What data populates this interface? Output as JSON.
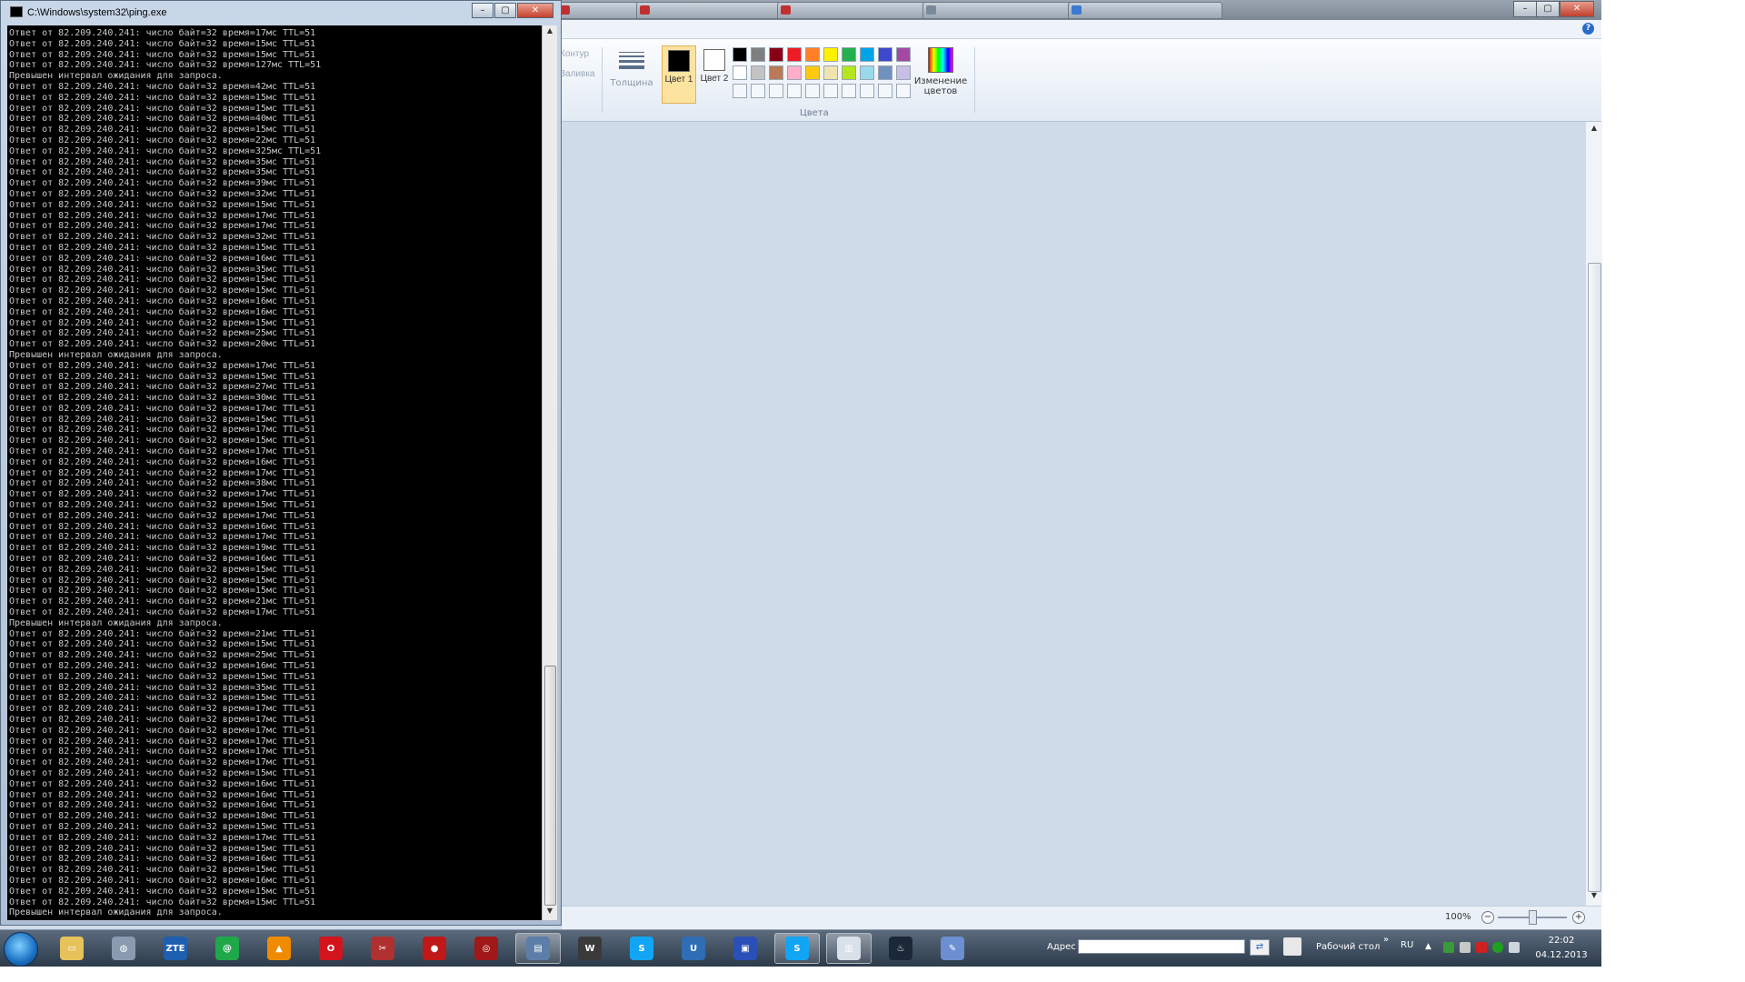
{
  "paint": {
    "tabs": [
      "",
      "",
      "",
      "",
      ""
    ],
    "window_buttons": {
      "minimize": "–",
      "maximize": "▢",
      "close": "✕"
    },
    "help": "?",
    "ribbon": {
      "outline_label": "Контур",
      "fill_label": "Заливка",
      "thickness_label": "Толщина",
      "color1_label": "Цвет 1",
      "color2_label": "Цвет 2",
      "colors_group_label": "Цвета",
      "edit_colors_label": "Изменение цветов",
      "color1_value": "#000000",
      "color2_value": "#ffffff",
      "palette": [
        "#000000",
        "#7f7f7f",
        "#880015",
        "#ed1c24",
        "#ff7f27",
        "#fff200",
        "#22b14c",
        "#00a2e8",
        "#3f48cc",
        "#a349a4",
        "#ffffff",
        "#c3c3c3",
        "#b97a57",
        "#ffaec9",
        "#ffc90e",
        "#efe4b0",
        "#b5e61d",
        "#99d9ea",
        "#7092be",
        "#c8bfe7",
        "#f4f7fb",
        "#f4f7fb",
        "#f4f7fb",
        "#f4f7fb",
        "#f4f7fb",
        "#f4f7fb",
        "#f4f7fb",
        "#f4f7fb",
        "#f4f7fb",
        "#f4f7fb"
      ]
    },
    "status": {
      "zoom": "100%",
      "zoom_out": "−",
      "zoom_in": "+",
      "zoom_fraction": 0.5
    }
  },
  "console": {
    "title": "C:\\Windows\\system32\\ping.exe",
    "buttons": {
      "minimize": "–",
      "maximize": "▢",
      "close": "✕"
    },
    "lines": [
      "Ответ от 82.209.240.241: число байт=32 время=17мс TTL=51",
      "Ответ от 82.209.240.241: число байт=32 время=15мс TTL=51",
      "Ответ от 82.209.240.241: число байт=32 время=15мс TTL=51",
      "Ответ от 82.209.240.241: число байт=32 время=127мс TTL=51",
      "Превышен интервал ожидания для запроса.",
      "Ответ от 82.209.240.241: число байт=32 время=42мс TTL=51",
      "Ответ от 82.209.240.241: число байт=32 время=15мс TTL=51",
      "Ответ от 82.209.240.241: число байт=32 время=15мс TTL=51",
      "Ответ от 82.209.240.241: число байт=32 время=40мс TTL=51",
      "Ответ от 82.209.240.241: число байт=32 время=15мс TTL=51",
      "Ответ от 82.209.240.241: число байт=32 время=22мс TTL=51",
      "Ответ от 82.209.240.241: число байт=32 время=325мс TTL=51",
      "Ответ от 82.209.240.241: число байт=32 время=35мс TTL=51",
      "Ответ от 82.209.240.241: число байт=32 время=35мс TTL=51",
      "Ответ от 82.209.240.241: число байт=32 время=39мс TTL=51",
      "Ответ от 82.209.240.241: число байт=32 время=32мс TTL=51",
      "Ответ от 82.209.240.241: число байт=32 время=15мс TTL=51",
      "Ответ от 82.209.240.241: число байт=32 время=17мс TTL=51",
      "Ответ от 82.209.240.241: число байт=32 время=17мс TTL=51",
      "Ответ от 82.209.240.241: число байт=32 время=32мс TTL=51",
      "Ответ от 82.209.240.241: число байт=32 время=15мс TTL=51",
      "Ответ от 82.209.240.241: число байт=32 время=16мс TTL=51",
      "Ответ от 82.209.240.241: число байт=32 время=35мс TTL=51",
      "Ответ от 82.209.240.241: число байт=32 время=15мс TTL=51",
      "Ответ от 82.209.240.241: число байт=32 время=15мс TTL=51",
      "Ответ от 82.209.240.241: число байт=32 время=16мс TTL=51",
      "Ответ от 82.209.240.241: число байт=32 время=16мс TTL=51",
      "Ответ от 82.209.240.241: число байт=32 время=15мс TTL=51",
      "Ответ от 82.209.240.241: число байт=32 время=25мс TTL=51",
      "Ответ от 82.209.240.241: число байт=32 время=20мс TTL=51",
      "Превышен интервал ожидания для запроса.",
      "Ответ от 82.209.240.241: число байт=32 время=17мс TTL=51",
      "Ответ от 82.209.240.241: число байт=32 время=15мс TTL=51",
      "Ответ от 82.209.240.241: число байт=32 время=27мс TTL=51",
      "Ответ от 82.209.240.241: число байт=32 время=30мс TTL=51",
      "Ответ от 82.209.240.241: число байт=32 время=17мс TTL=51",
      "Ответ от 82.209.240.241: число байт=32 время=15мс TTL=51",
      "Ответ от 82.209.240.241: число байт=32 время=17мс TTL=51",
      "Ответ от 82.209.240.241: число байт=32 время=15мс TTL=51",
      "Ответ от 82.209.240.241: число байт=32 время=17мс TTL=51",
      "Ответ от 82.209.240.241: число байт=32 время=16мс TTL=51",
      "Ответ от 82.209.240.241: число байт=32 время=17мс TTL=51",
      "Ответ от 82.209.240.241: число байт=32 время=38мс TTL=51",
      "Ответ от 82.209.240.241: число байт=32 время=17мс TTL=51",
      "Ответ от 82.209.240.241: число байт=32 время=15мс TTL=51",
      "Ответ от 82.209.240.241: число байт=32 время=17мс TTL=51",
      "Ответ от 82.209.240.241: число байт=32 время=16мс TTL=51",
      "Ответ от 82.209.240.241: число байт=32 время=17мс TTL=51",
      "Ответ от 82.209.240.241: число байт=32 время=19мс TTL=51",
      "Ответ от 82.209.240.241: число байт=32 время=16мс TTL=51",
      "Ответ от 82.209.240.241: число байт=32 время=15мс TTL=51",
      "Ответ от 82.209.240.241: число байт=32 время=15мс TTL=51",
      "Ответ от 82.209.240.241: число байт=32 время=15мс TTL=51",
      "Ответ от 82.209.240.241: число байт=32 время=21мс TTL=51",
      "Ответ от 82.209.240.241: число байт=32 время=17мс TTL=51",
      "Превышен интервал ожидания для запроса.",
      "Ответ от 82.209.240.241: число байт=32 время=21мс TTL=51",
      "Ответ от 82.209.240.241: число байт=32 время=15мс TTL=51",
      "Ответ от 82.209.240.241: число байт=32 время=25мс TTL=51",
      "Ответ от 82.209.240.241: число байт=32 время=16мс TTL=51",
      "Ответ от 82.209.240.241: число байт=32 время=15мс TTL=51",
      "Ответ от 82.209.240.241: число байт=32 время=35мс TTL=51",
      "Ответ от 82.209.240.241: число байт=32 время=15мс TTL=51",
      "Ответ от 82.209.240.241: число байт=32 время=17мс TTL=51",
      "Ответ от 82.209.240.241: число байт=32 время=17мс TTL=51",
      "Ответ от 82.209.240.241: число байт=32 время=17мс TTL=51",
      "Ответ от 82.209.240.241: число байт=32 время=17мс TTL=51",
      "Ответ от 82.209.240.241: число байт=32 время=17мс TTL=51",
      "Ответ от 82.209.240.241: число байт=32 время=17мс TTL=51",
      "Ответ от 82.209.240.241: число байт=32 время=15мс TTL=51",
      "Ответ от 82.209.240.241: число байт=32 время=16мс TTL=51",
      "Ответ от 82.209.240.241: число байт=32 время=16мс TTL=51",
      "Ответ от 82.209.240.241: число байт=32 время=16мс TTL=51",
      "Ответ от 82.209.240.241: число байт=32 время=18мс TTL=51",
      "Ответ от 82.209.240.241: число байт=32 время=15мс TTL=51",
      "Ответ от 82.209.240.241: число байт=32 время=17мс TTL=51",
      "Ответ от 82.209.240.241: число байт=32 время=15мс TTL=51",
      "Ответ от 82.209.240.241: число байт=32 время=16мс TTL=51",
      "Ответ от 82.209.240.241: число байт=32 время=15мс TTL=51",
      "Ответ от 82.209.240.241: число байт=32 время=16мс TTL=51",
      "Ответ от 82.209.240.241: число байт=32 время=15мс TTL=51",
      "Ответ от 82.209.240.241: число байт=32 время=15мс TTL=51",
      "Превышен интервал ожидания для запроса."
    ]
  },
  "taskbar": {
    "apps": [
      {
        "name": "explorer-folder",
        "icon": "folder-icon",
        "color": "#e6c25a",
        "glyph": "▭",
        "active": false
      },
      {
        "name": "network-globe",
        "icon": "globe-icon",
        "color": "#8a9bb0",
        "glyph": "◍",
        "active": false
      },
      {
        "name": "zte-modem",
        "icon": "zte-icon",
        "color": "#1e5fb0",
        "glyph": "ZTE",
        "active": false
      },
      {
        "name": "mail-agent",
        "icon": "at-icon",
        "color": "#1fa84a",
        "glyph": "@",
        "active": false
      },
      {
        "name": "aimp-player",
        "icon": "triangle-icon",
        "color": "#f08a00",
        "glyph": "▲",
        "active": false
      },
      {
        "name": "opera-browser",
        "icon": "opera-icon",
        "color": "#d4141c",
        "glyph": "O",
        "active": false
      },
      {
        "name": "tool-app",
        "icon": "tool-icon",
        "color": "#b03030",
        "glyph": "✂",
        "active": false
      },
      {
        "name": "ladybug-app",
        "icon": "ladybug-icon",
        "color": "#c01818",
        "glyph": "●",
        "active": false
      },
      {
        "name": "radar-app",
        "icon": "radar-icon",
        "color": "#a01818",
        "glyph": "◎",
        "active": false
      },
      {
        "name": "paint-app",
        "icon": "paint-icon",
        "color": "#5d7ea8",
        "glyph": "▤",
        "active": true
      },
      {
        "name": "world-of-tanks",
        "icon": "wot-icon",
        "color": "#3a3a3a",
        "glyph": "W",
        "active": false
      },
      {
        "name": "skype",
        "icon": "skype-icon",
        "color": "#12a5f4",
        "glyph": "S",
        "active": false
      },
      {
        "name": "uplay",
        "icon": "uplay-icon",
        "color": "#2f6db5",
        "glyph": "U",
        "active": false
      },
      {
        "name": "save-app",
        "icon": "floppy-icon",
        "color": "#2a50b8",
        "glyph": "▣",
        "active": false
      },
      {
        "name": "skype-2",
        "icon": "skype-icon",
        "color": "#12a5f4",
        "glyph": "S",
        "active": true
      },
      {
        "name": "console-window",
        "icon": "console-icon",
        "color": "#d8e0ea",
        "glyph": "▥",
        "active": true
      },
      {
        "name": "steam",
        "icon": "steam-icon",
        "color": "#1b2838",
        "glyph": "♨",
        "active": false
      },
      {
        "name": "paint-brush",
        "icon": "brush-icon",
        "color": "#6b8fd0",
        "glyph": "✎",
        "active": false
      }
    ],
    "address_label": "Адрес",
    "address_value": "",
    "desktop_label": "Рабочий стол",
    "desktop_chevron": "»",
    "language": "RU",
    "clock_time": "22:02",
    "clock_date": "04.12.2013"
  }
}
